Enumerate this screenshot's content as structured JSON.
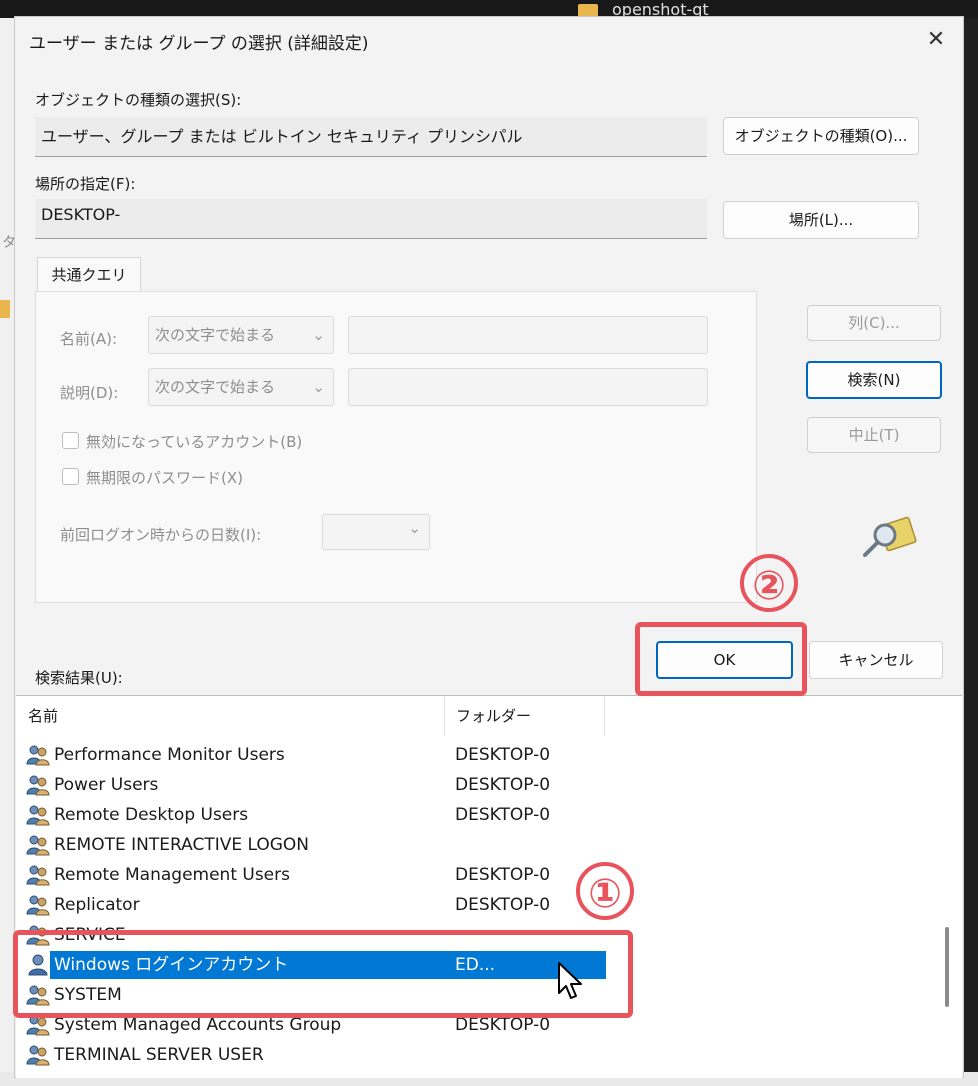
{
  "background": {
    "folder_text": "openshot-qt",
    "left_glyph": "タ"
  },
  "dialog": {
    "title": "ユーザー または グループ の選択 (詳細設定)",
    "close_icon": "close-icon",
    "object_type_label": "オブジェクトの種類の選択(S):",
    "object_type_value": "ユーザー、グループ または ビルトイン セキュリティ プリンシパル",
    "object_type_button": "オブジェクトの種類(O)...",
    "location_label": "場所の指定(F):",
    "location_value": "DESKTOP-",
    "location_button": "場所(L)...",
    "tab_label": "共通クエリ",
    "name_label": "名前(A):",
    "name_condition": "次の文字で始まる",
    "description_label": "説明(D):",
    "description_condition": "次の文字で始まる",
    "disabled_accounts_label": "無効になっているアカウント(B)",
    "nonexpiring_password_label": "無期限のパスワード(X)",
    "days_since_logon_label": "前回ログオン時からの日数(I):",
    "columns_button": "列(C)...",
    "search_button": "検索(N)",
    "stop_button": "中止(T)",
    "ok_button": "OK",
    "cancel_button": "キャンセル",
    "results_label": "検索結果(U):"
  },
  "results": {
    "columns": [
      "名前",
      "フォルダー"
    ],
    "rows": [
      {
        "name": "Performance Monitor Users",
        "folder": "DESKTOP-0"
      },
      {
        "name": "Power Users",
        "folder": "DESKTOP-0"
      },
      {
        "name": "Remote Desktop Users",
        "folder": "DESKTOP-0"
      },
      {
        "name": "REMOTE INTERACTIVE LOGON",
        "folder": ""
      },
      {
        "name": "Remote Management Users",
        "folder": "DESKTOP-0"
      },
      {
        "name": "Replicator",
        "folder": "DESKTOP-0"
      },
      {
        "name": "SERVICE",
        "folder": ""
      },
      {
        "name": "Windows ログインアカウント",
        "folder": "ED..."
      },
      {
        "name": "SYSTEM",
        "folder": ""
      },
      {
        "name": "System Managed Accounts Group",
        "folder": "DESKTOP-0"
      },
      {
        "name": "TERMINAL SERVER USER",
        "folder": ""
      }
    ],
    "selected_index": 7
  },
  "annotations": {
    "step1": "①",
    "step2": "②",
    "color": "#e8545c"
  },
  "colors": {
    "selection": "#0078d4",
    "accent": "#0067c0"
  }
}
